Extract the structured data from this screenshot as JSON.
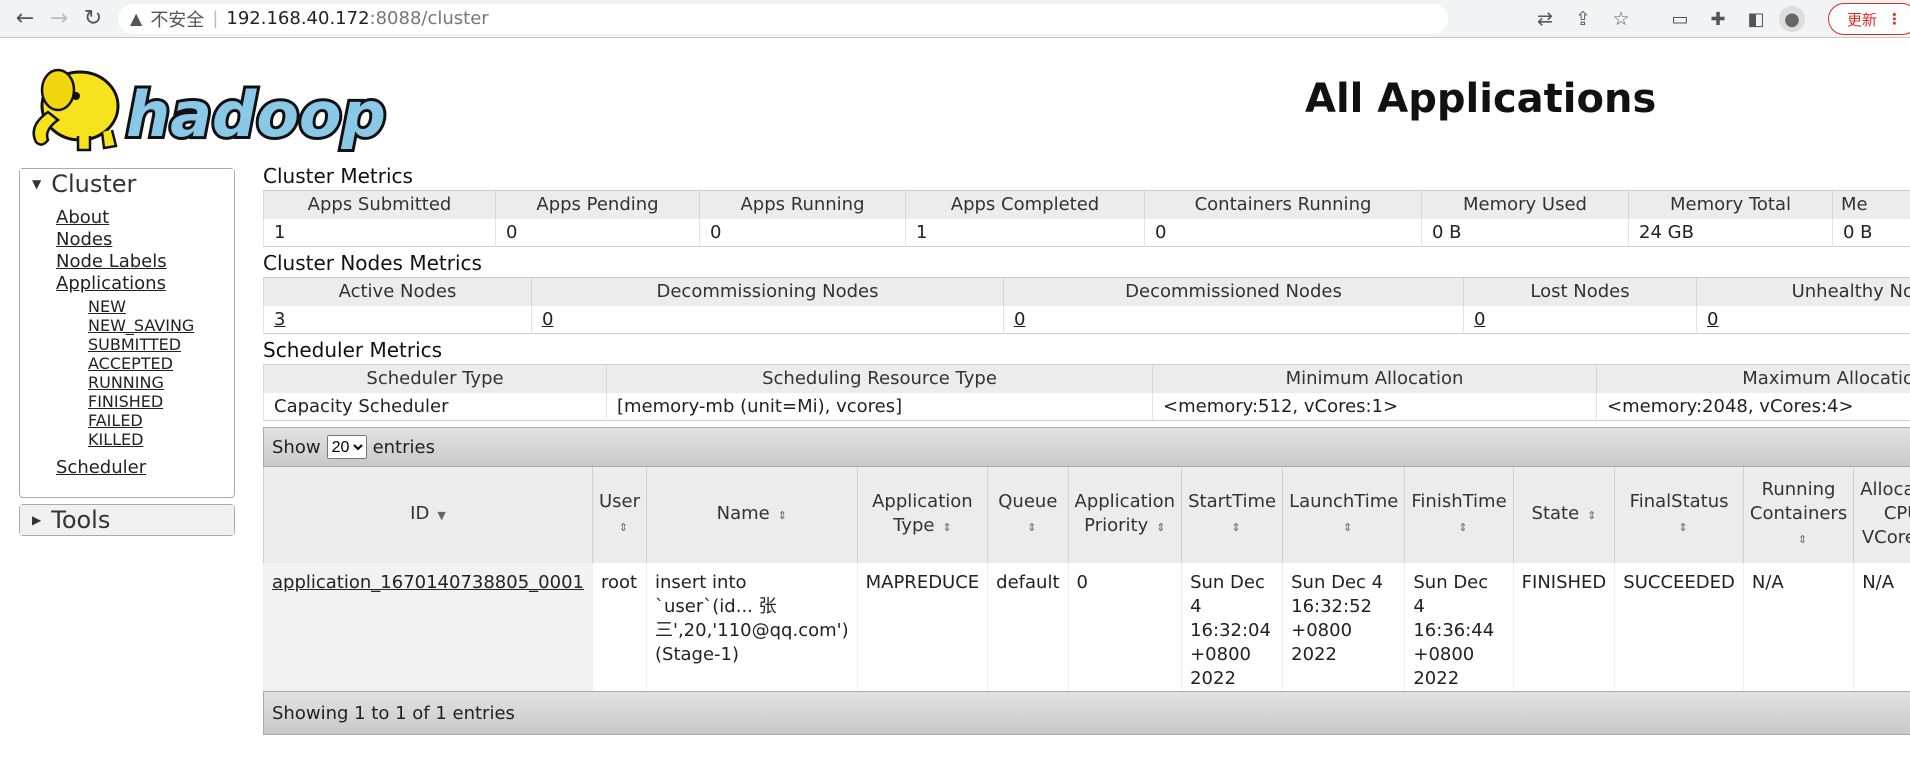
{
  "browser": {
    "back_icon": "←",
    "forward_icon": "→",
    "reload_icon": "↻",
    "security_label": "不安全",
    "url_host": "192.168.40.172",
    "url_path": ":8088/cluster",
    "update_label": "更新",
    "update_menu_icon": "⋮"
  },
  "header": {
    "logo_text": "hadoop",
    "page_title": "All Applications"
  },
  "sidebar": {
    "cluster_label": "Cluster",
    "links": [
      "About",
      "Nodes",
      "Node Labels",
      "Applications"
    ],
    "app_states": [
      "NEW",
      "NEW_SAVING",
      "SUBMITTED",
      "ACCEPTED",
      "RUNNING",
      "FINISHED",
      "FAILED",
      "KILLED"
    ],
    "scheduler_label": "Scheduler",
    "tools_label": "Tools"
  },
  "cluster_metrics": {
    "title": "Cluster Metrics",
    "headers": [
      "Apps Submitted",
      "Apps Pending",
      "Apps Running",
      "Apps Completed",
      "Containers Running",
      "Memory Used",
      "Memory Total",
      "Me"
    ],
    "values": [
      "1",
      "0",
      "0",
      "1",
      "0",
      "0 B",
      "24 GB",
      "0 B"
    ]
  },
  "cluster_nodes_metrics": {
    "title": "Cluster Nodes Metrics",
    "headers": [
      "Active Nodes",
      "Decommissioning Nodes",
      "Decommissioned Nodes",
      "Lost Nodes",
      "Unhealthy No"
    ],
    "values": [
      "3",
      "0",
      "0",
      "0",
      "0"
    ]
  },
  "scheduler_metrics": {
    "title": "Scheduler Metrics",
    "headers": [
      "Scheduler Type",
      "Scheduling Resource Type",
      "Minimum Allocation",
      "Maximum Allocatio"
    ],
    "values": [
      "Capacity Scheduler",
      "[memory-mb (unit=Mi), vcores]",
      "<memory:512, vCores:1>",
      "<memory:2048, vCores:4>"
    ]
  },
  "apps_table": {
    "show_label": "Show",
    "page_size": "20",
    "entries_label": "entries",
    "headers": [
      "ID",
      "User",
      "Name",
      "Application Type",
      "Queue",
      "Application Priority",
      "StartTime",
      "LaunchTime",
      "FinishTime",
      "State",
      "FinalStatus",
      "Running Containers",
      "Allocated CPU VCores"
    ],
    "rows": [
      {
        "id": "application_1670140738805_0001",
        "user": "root",
        "name": "insert into `user`(id... 张三',20,'110@qq.com') (Stage-1)",
        "type": "MAPREDUCE",
        "queue": "default",
        "priority": "0",
        "start": "Sun Dec 4 16:32:04 +0800 2022",
        "launch": "Sun Dec 4 16:32:52 +0800 2022",
        "finish": "Sun Dec 4 16:36:44 +0800 2022",
        "state": "FINISHED",
        "final_status": "SUCCEEDED",
        "running_containers": "N/A",
        "alloc_vcores": "N/A"
      }
    ],
    "footer": "Showing 1 to 1 of 1 entries"
  }
}
